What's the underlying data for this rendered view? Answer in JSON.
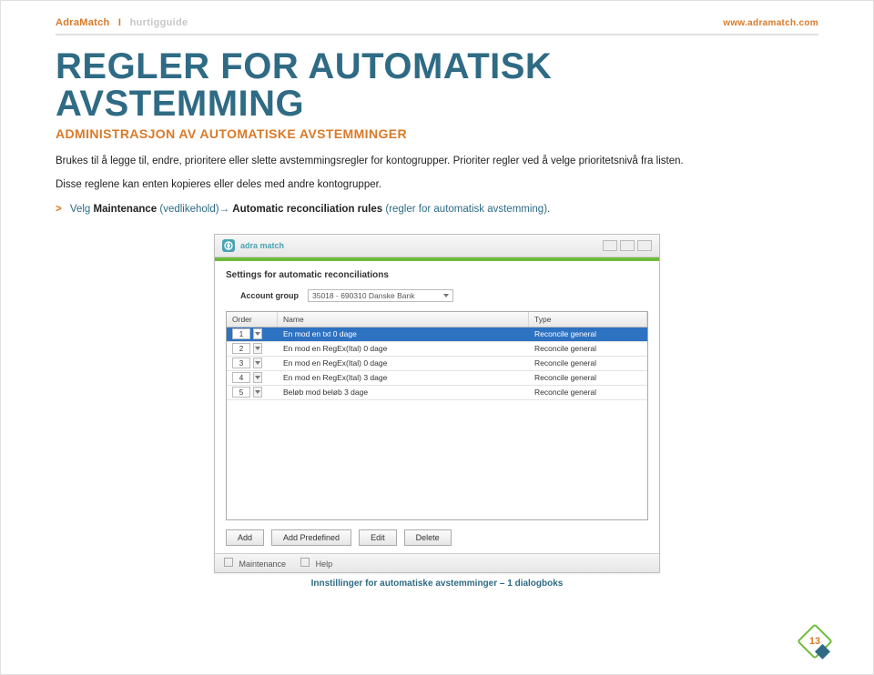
{
  "header": {
    "brand": "AdraMatch",
    "separator": "I",
    "doc_type": "hurtigguide",
    "url": "www.adramatch.com"
  },
  "title_line1": "REGLER FOR AUTOMATISK",
  "title_line2": "AVSTEMMING",
  "subtitle": "ADMINISTRASJON AV AUTOMATISKE AVSTEMMINGER",
  "para1": "Brukes til å legge til, endre, prioritere eller slette avstemmingsregler for kontogrupper. Prioriter regler ved å velge prioritetsnivå fra listen.",
  "para2": "Disse reglene kan enten kopieres eller deles med andre kontogrupper.",
  "instruction_prefix": "Velg ",
  "instruction_bold1": "Maintenance",
  "instruction_mid1": " (vedlikehold)→ ",
  "instruction_bold2": "Automatic reconciliation rules",
  "instruction_mid2": " (regler for automatisk avstemming).",
  "window": {
    "brand_mini": "adra match",
    "settings_title": "Settings for automatic reconciliations",
    "account_group_label": "Account group",
    "account_group_value": "35018 - 690310 Danske Bank",
    "columns": {
      "order": "Order",
      "name": "Name",
      "type": "Type"
    },
    "rows": [
      {
        "order": "1",
        "name": "En mod en txt 0 dage",
        "type": "Reconcile general",
        "selected": true
      },
      {
        "order": "2",
        "name": "En mod en RegEx(Ital) 0 dage",
        "type": "Reconcile general",
        "selected": false
      },
      {
        "order": "3",
        "name": "En mod en RegEx(Ital) 0 dage",
        "type": "Reconcile general",
        "selected": false
      },
      {
        "order": "4",
        "name": "En mod en RegEx(Ital) 3 dage",
        "type": "Reconcile general",
        "selected": false
      },
      {
        "order": "5",
        "name": "Beløb mod beløb 3 dage",
        "type": "Reconcile general",
        "selected": false
      }
    ],
    "buttons": {
      "add": "Add",
      "add_predefined": "Add Predefined",
      "edit": "Edit",
      "delete": "Delete"
    },
    "status": {
      "maintenance": "Maintenance",
      "help": "Help"
    }
  },
  "caption": "Innstillinger for automatiske avstemminger – 1 dialogboks",
  "page_number": "13"
}
